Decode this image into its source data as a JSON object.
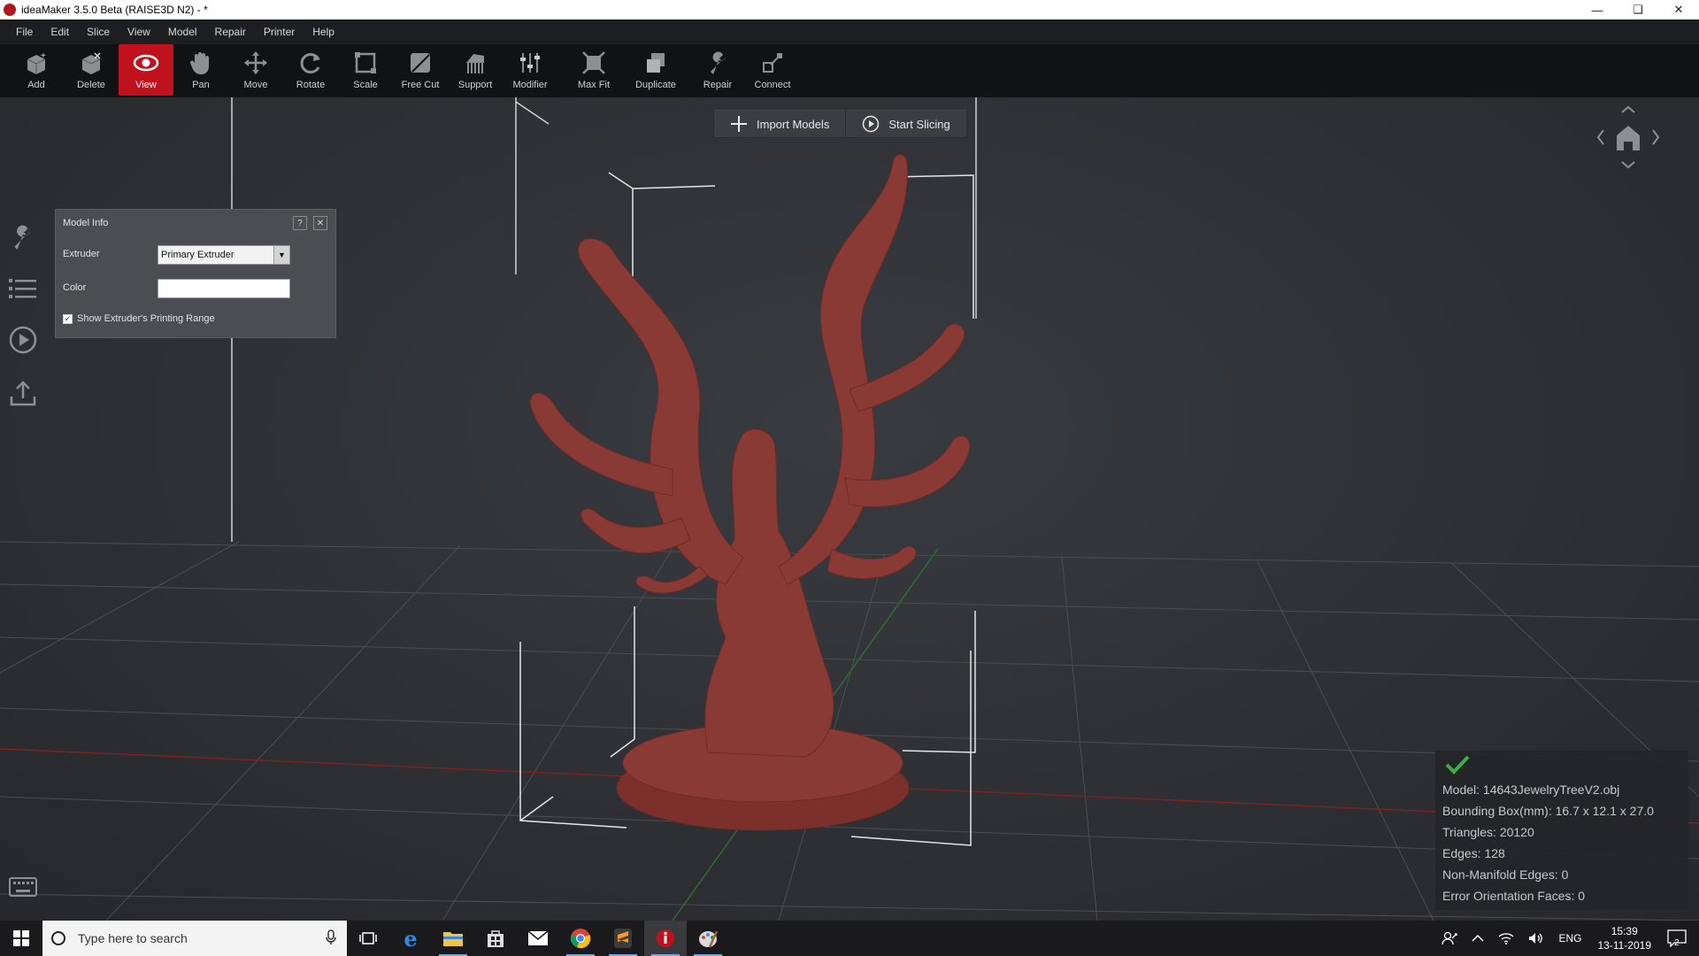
{
  "window": {
    "title": "ideaMaker 3.5.0 Beta (RAISE3D N2) - *",
    "controls": [
      "minimize-icon",
      "restore-icon",
      "close-icon"
    ]
  },
  "menu": [
    "File",
    "Edit",
    "Slice",
    "View",
    "Model",
    "Repair",
    "Printer",
    "Help"
  ],
  "toolbar": [
    {
      "label": "Add",
      "icon": "add-icon",
      "active": false
    },
    {
      "label": "Delete",
      "icon": "delete-icon",
      "active": false
    },
    {
      "label": "View",
      "icon": "eye-icon",
      "active": true
    },
    {
      "label": "Pan",
      "icon": "hand-icon",
      "active": false
    },
    {
      "label": "Move",
      "icon": "move-icon",
      "active": false
    },
    {
      "label": "Rotate",
      "icon": "rotate-icon",
      "active": false
    },
    {
      "label": "Scale",
      "icon": "scale-icon",
      "active": false
    },
    {
      "label": "Free Cut",
      "icon": "cut-icon",
      "active": false
    },
    {
      "label": "Support",
      "icon": "support-icon",
      "active": false
    },
    {
      "label": "Modifier",
      "icon": "modifier-icon",
      "active": false
    },
    {
      "label": "Max Fit",
      "icon": "maxfit-icon",
      "active": false
    },
    {
      "label": "Duplicate",
      "icon": "duplicate-icon",
      "active": false
    },
    {
      "label": "Repair",
      "icon": "wrench-icon",
      "active": false
    },
    {
      "label": "Connect",
      "icon": "connect-icon",
      "active": false
    }
  ],
  "actions": {
    "import_label": "Import Models",
    "slice_label": "Start Slicing"
  },
  "left_sidebar": [
    "wrench-icon",
    "list-icon",
    "play-icon",
    "upload-icon",
    "keyboard-icon"
  ],
  "model_info": {
    "title": "Model Info",
    "help": "?",
    "close": "✕",
    "extruder_label": "Extruder",
    "extruder_value": "Primary Extruder",
    "color_label": "Color",
    "color_value": "#ffffff",
    "show_range_label": "Show Extruder's Printing Range",
    "show_range_checked": true
  },
  "info": {
    "model": "Model: 14643JewelryTreeV2.obj",
    "bbox": "Bounding Box(mm): 16.7 x 12.1 x 27.0",
    "triangles": "Triangles: 20120",
    "edges": "Edges: 128",
    "non_manifold": "Non-Manifold Edges: 0",
    "error_faces": "Error Orientation Faces: 0",
    "status": "ok"
  },
  "taskbar": {
    "search_placeholder": "Type here to search",
    "apps": [
      "task-view-icon",
      "edge-icon",
      "file-explorer-icon",
      "store-icon",
      "mail-icon",
      "chrome-icon",
      "sublime-icon",
      "ideamaker-icon",
      "paint-icon"
    ],
    "lang": "ENG",
    "time": "15:39",
    "date": "13-11-2019",
    "notifications": "2"
  },
  "colors": {
    "model": "#8a3a35",
    "accent": "#c0121c",
    "ok": "#3cb043"
  }
}
